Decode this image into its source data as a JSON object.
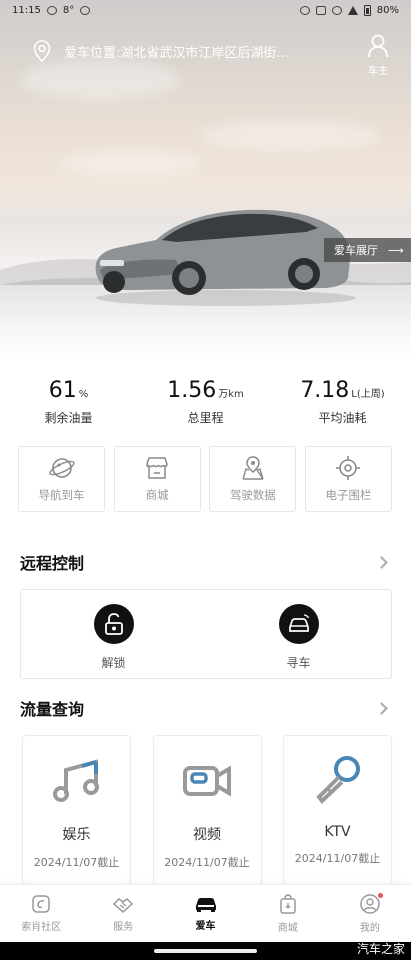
{
  "status_bar": {
    "time": "11:15",
    "temp": "8°",
    "battery": "80%"
  },
  "header": {
    "location": "爱车位置:湖北省武汉市江岸区后湖街...",
    "owner_label": "车主"
  },
  "hero": {
    "showroom_label": "爱车展厅"
  },
  "stats": [
    {
      "value": "61",
      "unit": "%",
      "label": "剩余油量"
    },
    {
      "value": "1.56",
      "unit": "万km",
      "label": "总里程"
    },
    {
      "value": "7.18",
      "unit": "L(上周)",
      "label": "平均油耗"
    }
  ],
  "quick_actions": [
    {
      "label": "导航到车",
      "icon": "planet-icon"
    },
    {
      "label": "商城",
      "icon": "store-icon"
    },
    {
      "label": "驾驶数据",
      "icon": "map-pin-icon"
    },
    {
      "label": "电子围栏",
      "icon": "target-icon"
    }
  ],
  "remote": {
    "title": "远程控制",
    "actions": [
      {
        "label": "解锁",
        "icon": "unlock-icon"
      },
      {
        "label": "寻车",
        "icon": "car-find-icon"
      }
    ]
  },
  "traffic": {
    "title": "流量查询",
    "cards": [
      {
        "name": "娱乐",
        "date": "2024/11/07截止",
        "icon": "music-icon"
      },
      {
        "name": "视频",
        "date": "2024/11/07截止",
        "icon": "video-icon"
      },
      {
        "name": "KTV",
        "date": "2024/11/07截止",
        "icon": "microphone-icon"
      }
    ]
  },
  "tabs": [
    {
      "label": "索肖社区",
      "icon": "community-icon",
      "active": false
    },
    {
      "label": "服务",
      "icon": "handshake-icon",
      "active": false
    },
    {
      "label": "爱车",
      "icon": "car-icon",
      "active": true
    },
    {
      "label": "商城",
      "icon": "shopping-bag-icon",
      "active": false
    },
    {
      "label": "我的",
      "icon": "profile-icon",
      "active": false
    }
  ],
  "watermark": "汽车之家",
  "colors": {
    "accent": "#111111",
    "notify_dot": "#e8505b",
    "icon_blue": "#4a86b4"
  }
}
